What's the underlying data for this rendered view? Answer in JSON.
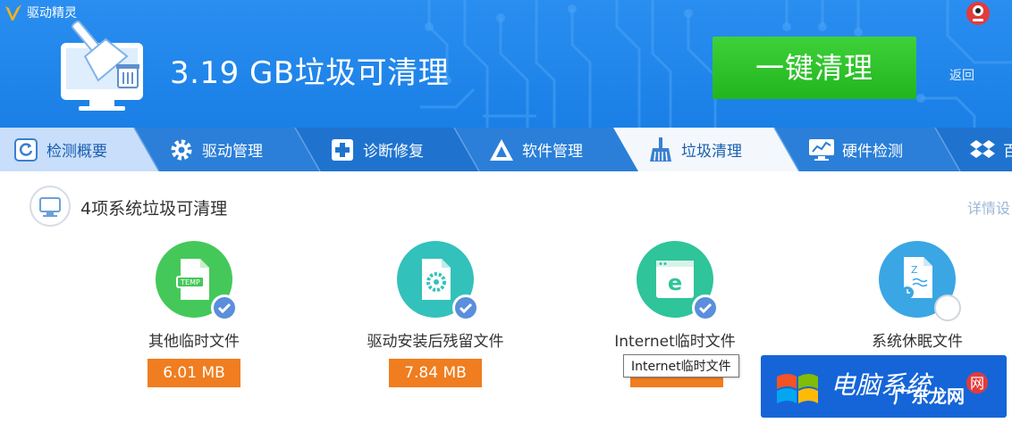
{
  "app": {
    "name": "驱动精灵"
  },
  "header": {
    "headline": "3.19 GB垃圾可清理",
    "clean_button": "一键清理",
    "back": "返回"
  },
  "tabs": [
    {
      "label": "检测概要",
      "icon": "refresh-icon"
    },
    {
      "label": "驱动管理",
      "icon": "gear-icon"
    },
    {
      "label": "诊断修复",
      "icon": "medical-cross-icon"
    },
    {
      "label": "软件管理",
      "icon": "software-triangle-icon"
    },
    {
      "label": "垃圾清理",
      "icon": "broom-icon",
      "active": true
    },
    {
      "label": "硬件检测",
      "icon": "monitor-chart-icon"
    }
  ],
  "section": {
    "title": "4项系统垃圾可清理",
    "detail": "详情设"
  },
  "items": [
    {
      "label": "其他临时文件",
      "size": "6.01 MB",
      "color": "#45c85a",
      "checked": true
    },
    {
      "label": "驱动安装后残留文件",
      "size": "7.84 MB",
      "color": "#33c1bc",
      "checked": true
    },
    {
      "label": "Internet临时文件",
      "size": "",
      "color": "#2fc499",
      "checked": true
    },
    {
      "label": "系统休眠文件",
      "size": "",
      "color": "#3aa6e4",
      "checked": false
    }
  ],
  "tooltip": "Internet临时文件",
  "colors": {
    "header_blue": "#2a8ef0",
    "tab_blue": "#1a6fcf",
    "clean_green": "#2dc428",
    "size_orange": "#f07d1f",
    "watermark_blue": "#1565d8"
  }
}
